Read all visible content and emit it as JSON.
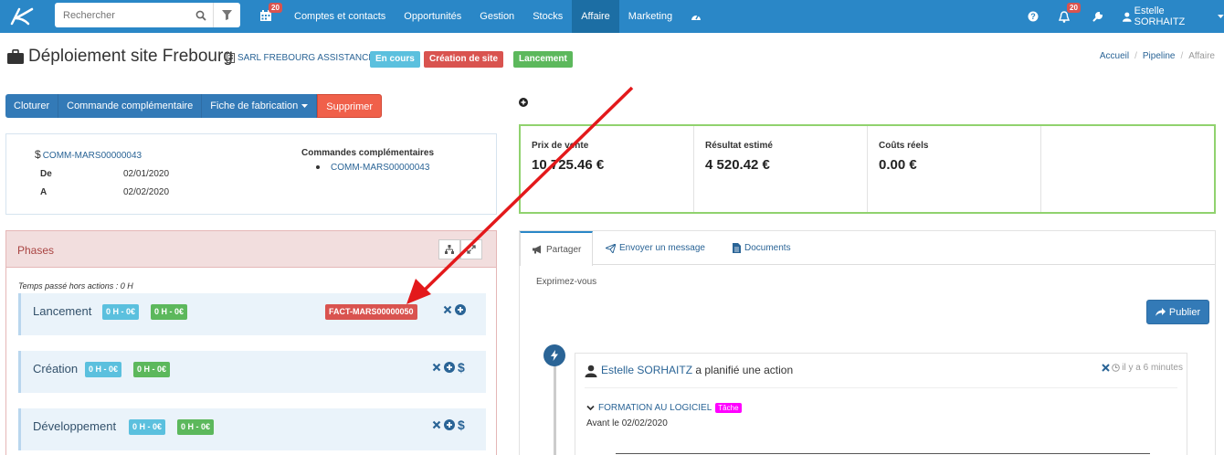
{
  "navbar": {
    "search_placeholder": "Rechercher",
    "calendar_badge": "20",
    "menu": [
      "Comptes et contacts",
      "Opportunités",
      "Gestion",
      "Stocks",
      "Affaire",
      "Marketing"
    ],
    "active_menu": "Affaire",
    "notif_badge": "20",
    "user_name": "Estelle SORHAITZ"
  },
  "header": {
    "title": "Déploiement site Frebourg",
    "company": "SARL FREBOURG ASSISTANCE",
    "labels": [
      {
        "text": "En cours",
        "color": "#5bc0de"
      },
      {
        "text": "Création de site",
        "color": "#d9534f"
      },
      {
        "text": "Lancement",
        "color": "#5cb85c"
      }
    ],
    "breadcrumb": [
      "Accueil",
      "Pipeline",
      "Affaire"
    ]
  },
  "actions": {
    "close": "Cloturer",
    "complementary": "Commande complémentaire",
    "fabrication": "Fiche de fabrication",
    "delete": "Supprimer"
  },
  "info": {
    "ref": "COMM-MARS00000043",
    "from_label": "De",
    "from_value": "02/01/2020",
    "to_label": "A",
    "to_value": "02/02/2020",
    "cc_title": "Commandes complémentaires",
    "cc_item": "COMM-MARS00000043"
  },
  "phases": {
    "title": "Phases",
    "time_note": "Temps passé hors actions : 0 H",
    "items": [
      {
        "name": "Lancement",
        "t1": "0 H - 0€",
        "t2": "0 H - 0€",
        "invoice": "FACT-MARS00000050"
      },
      {
        "name": "Création",
        "t1": "0 H - 0€",
        "t2": "0 H - 0€"
      },
      {
        "name": "Développement",
        "t1": "0 H - 0€",
        "t2": "0 H - 0€"
      }
    ]
  },
  "stats": [
    {
      "label": "Prix de vente",
      "value": "10 725.46 €"
    },
    {
      "label": "Résultat estimé",
      "value": "4 520.42 €"
    },
    {
      "label": "Coûts réels",
      "value": "0.00 €"
    }
  ],
  "feed": {
    "tabs": [
      "Partager",
      "Envoyer un message",
      "Documents"
    ],
    "placeholder": "Exprimez-vous",
    "publish": "Publier",
    "activity": {
      "user": "Estelle SORHAITZ",
      "action": "a planifié une action",
      "when": "il y a 6 minutes",
      "task": "FORMATION AU LOGICIEL",
      "task_tag": "Tâche",
      "due": "Avant le 02/02/2020"
    }
  }
}
